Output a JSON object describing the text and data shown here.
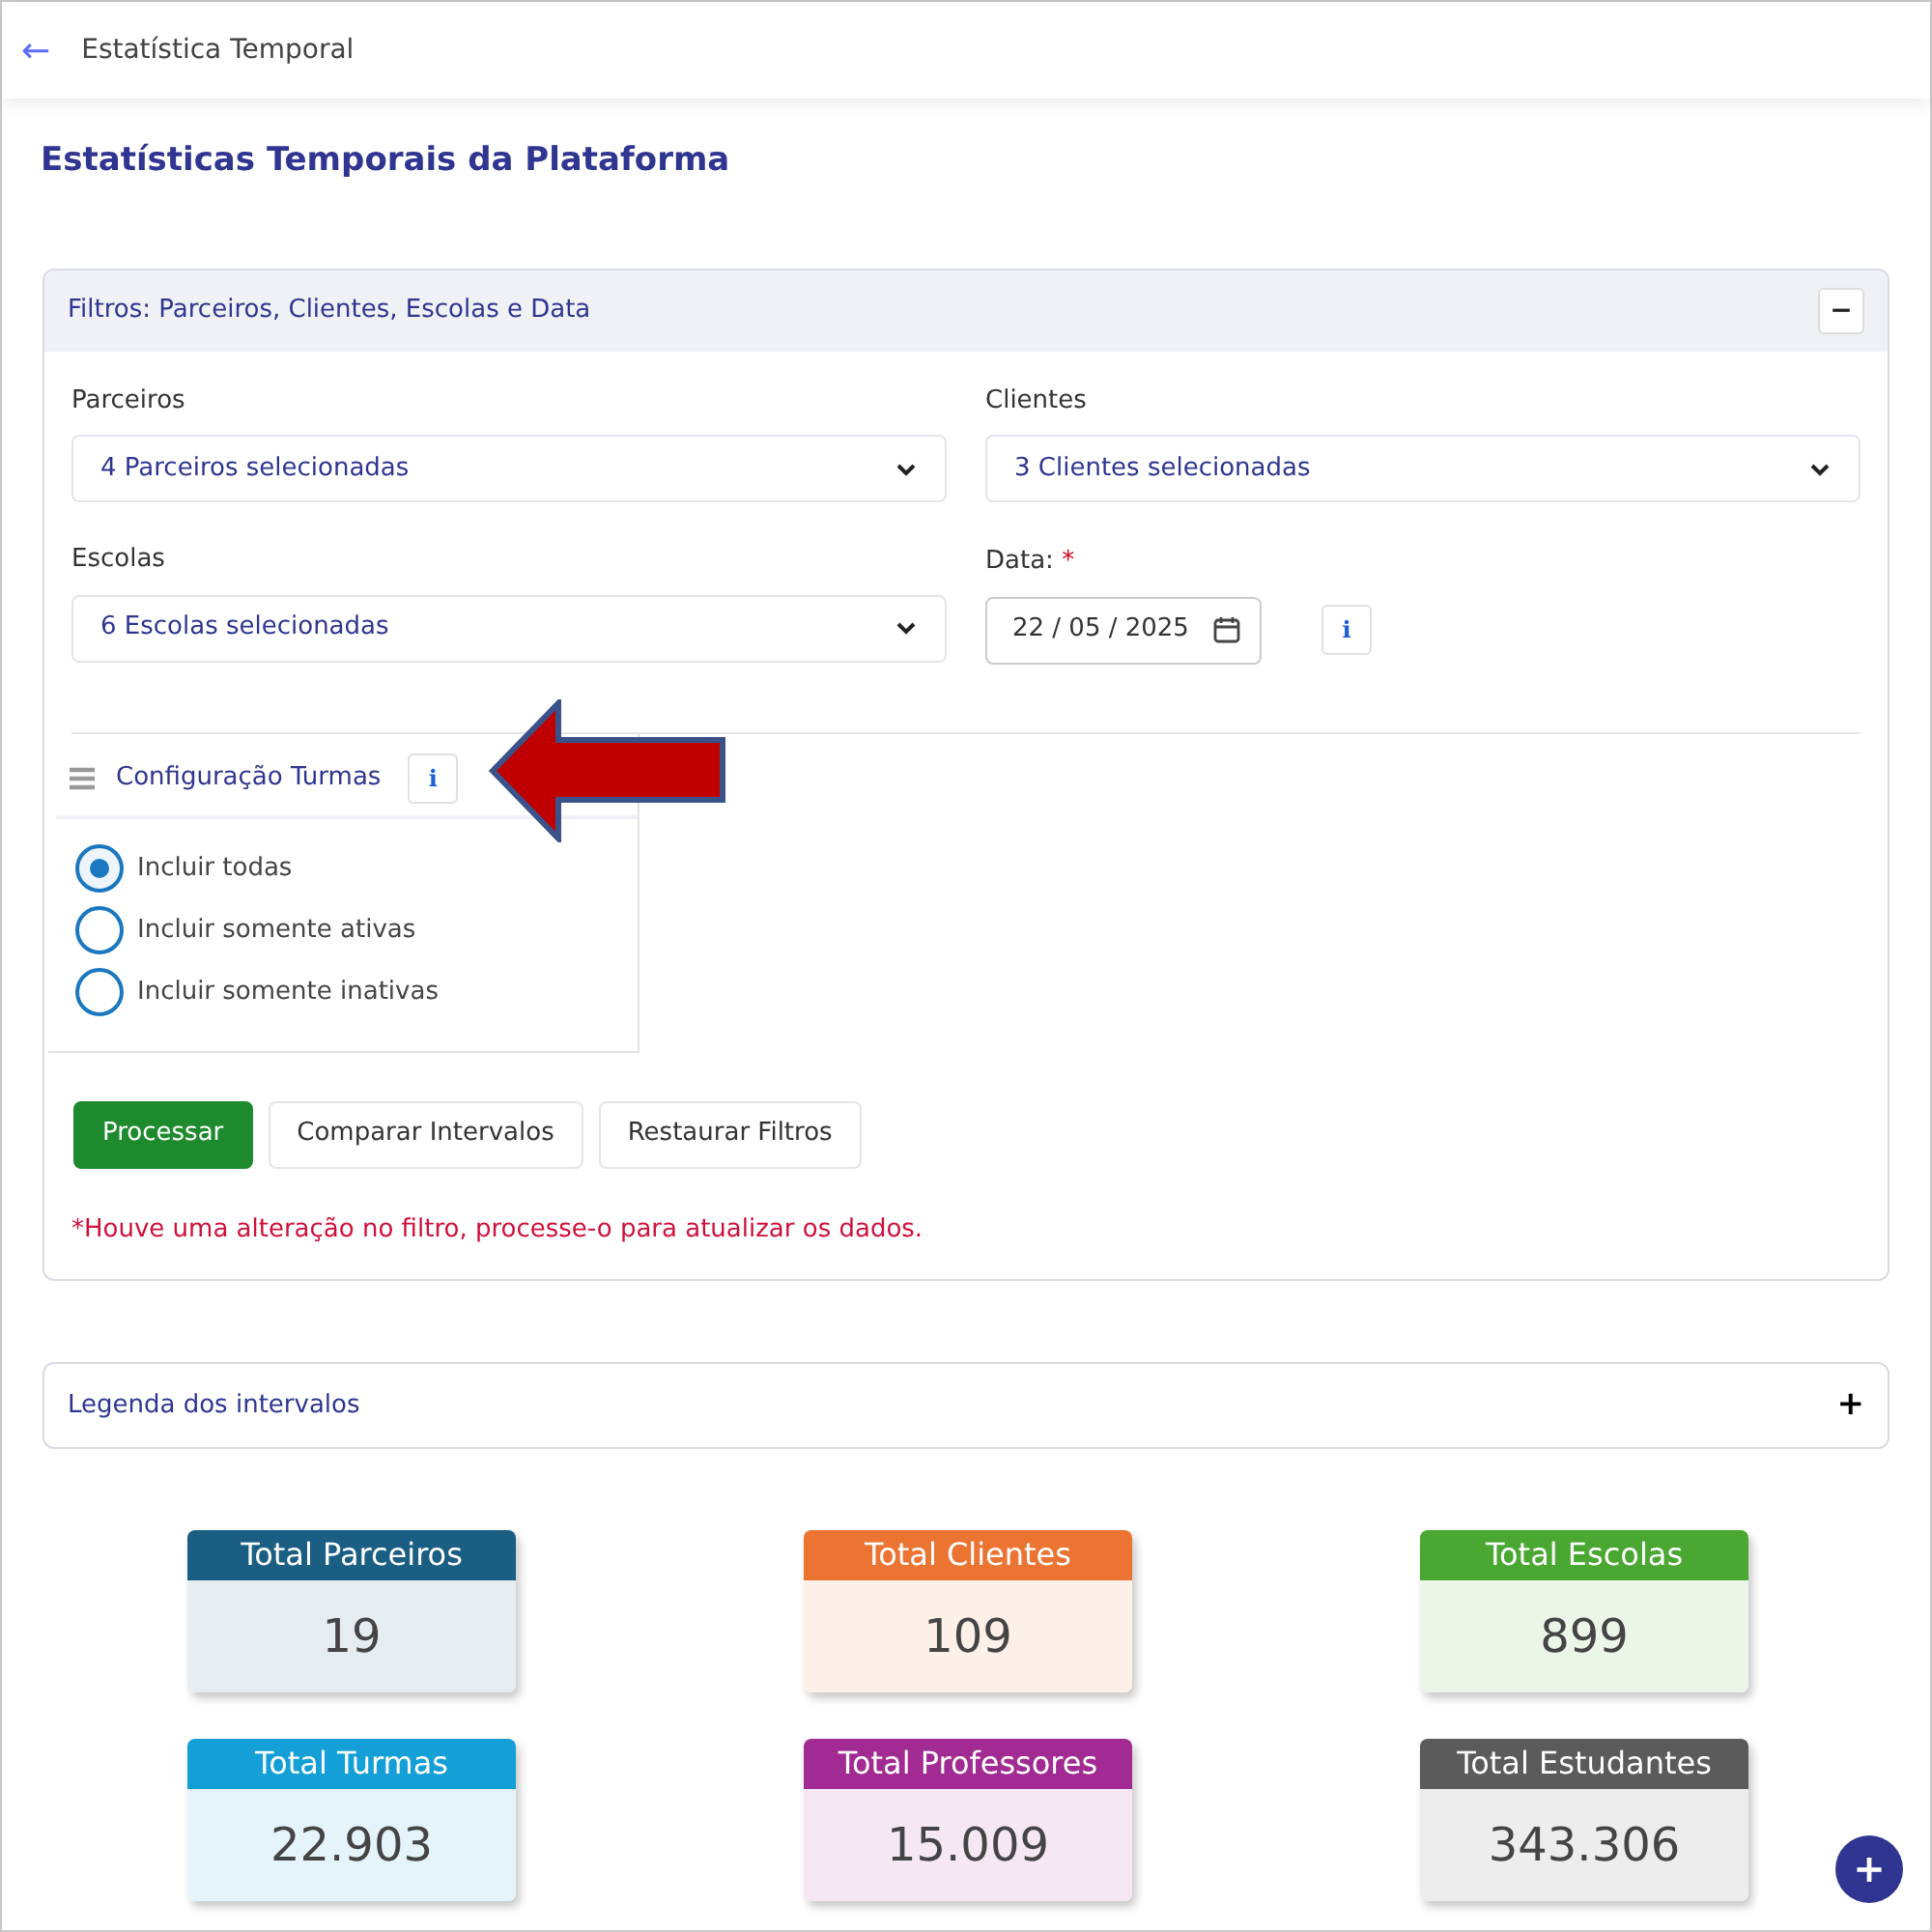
{
  "header": {
    "back_icon": "←",
    "title": "Estatística Temporal"
  },
  "page_title": "Estatísticas Temporais da Plataforma",
  "filters": {
    "title": "Filtros: Parceiros, Clientes, Escolas e Data",
    "collapse_symbol": "−",
    "expanded": true,
    "selects": [
      {
        "label": "Parceiros",
        "value": "4 Parceiros selecionadas"
      },
      {
        "label": "Clientes",
        "value": "3 Clientes selecionadas"
      },
      {
        "label": "Escolas",
        "value": "6 Escolas selecionadas"
      }
    ],
    "date": {
      "label": "Data:",
      "required_mark": "*",
      "value": "22 / 05 / 2025",
      "info_symbol": "i"
    },
    "turmas": {
      "title": "Configuração Turmas",
      "info_symbol": "i",
      "options": [
        {
          "label": "Incluir todas",
          "selected": true
        },
        {
          "label": "Incluir somente ativas",
          "selected": false
        },
        {
          "label": "Incluir somente inativas",
          "selected": false
        }
      ]
    },
    "buttons": [
      {
        "label": "Processar",
        "kind": "primary"
      },
      {
        "label": "Comparar Intervalos",
        "kind": "default"
      },
      {
        "label": "Restaurar Filtros",
        "kind": "default"
      }
    ],
    "warning": "*Houve uma alteração no filtro, processe-o para atualizar os dados."
  },
  "legend": {
    "title": "Legenda dos intervalos",
    "expand_symbol": "+",
    "expanded": false
  },
  "stats": [
    {
      "label": "Total Parceiros",
      "value": "19",
      "color": "#1b5e84"
    },
    {
      "label": "Total Clientes",
      "value": "109",
      "color": "#ec7433"
    },
    {
      "label": "Total Escolas",
      "value": "899",
      "color": "#4aa832"
    },
    {
      "label": "Total Turmas",
      "value": "22.903",
      "color": "#149fd6"
    },
    {
      "label": "Total Professores",
      "value": "15.009",
      "color": "#a22b93"
    },
    {
      "label": "Total Estudantes",
      "value": "343.306",
      "color": "#5b5b5b"
    }
  ],
  "fab_symbol": "+"
}
